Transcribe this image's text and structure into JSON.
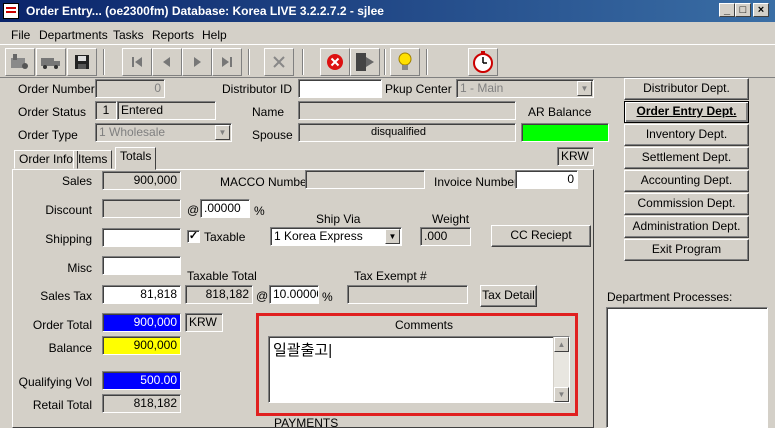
{
  "window": {
    "title": "Order Entry... (oe2300fm)  Database: Korea LIVE 3.2.2.7.2 - sjlee",
    "min": "_",
    "max": "□",
    "close": "×"
  },
  "menu": [
    "File",
    "Departments",
    "Tasks",
    "Reports",
    "Help"
  ],
  "toolbar": {
    "icons": [
      "tools-icon",
      "truck-icon",
      "save-icon",
      "first-record-icon",
      "previous-record-icon",
      "next-record-icon",
      "last-record-icon",
      "delete-icon",
      "cancel-icon",
      "exit-icon",
      "help-bulb-icon",
      "timer-icon"
    ]
  },
  "header": {
    "order_number_label": "Order Number",
    "order_number_value": "0",
    "distributor_id_label": "Distributor ID",
    "distributor_id_value": "",
    "pkup_center_label": "Pkup Center",
    "pkup_center_value": "1 - Main",
    "order_status_label": "Order Status",
    "order_status_code": "1",
    "order_status_value": "Entered",
    "name_label": "Name",
    "name_value": "",
    "ar_balance_label": "AR Balance",
    "ar_balance_color": "#00ff00",
    "order_type_label": "Order Type",
    "order_type_value": "1 Wholesale",
    "spouse_label": "Spouse",
    "spouse_value": "disqualified",
    "currency": "KRW"
  },
  "tabs": [
    "Order Info",
    "Items",
    "Totals"
  ],
  "active_tab": "Totals",
  "totals": {
    "sales_label": "Sales",
    "sales_value": "900,000",
    "macco_label": "MACCO Number",
    "macco_value": "",
    "invoice_label": "Invoice Number",
    "invoice_value": "0",
    "discount_label": "Discount",
    "discount_value": "",
    "discount_at": "@",
    "discount_pct": ".00000",
    "pct_sign": "%",
    "ship_via_label": "Ship Via",
    "ship_via_value": "1 Korea Express",
    "weight_label": "Weight",
    "weight_value": ".000",
    "shipping_label": "Shipping",
    "shipping_value": "",
    "taxable_label": "Taxable",
    "taxable_checked": "✓",
    "cc_button": "CC Reciept",
    "misc_label": "Misc",
    "misc_value": "",
    "taxable_total_label": "Taxable Total",
    "tax_exempt_label": "Tax Exempt #",
    "sales_tax_label": "Sales Tax",
    "sales_tax_value": "81,818",
    "taxable_total_value": "818,182",
    "tax_at": "@",
    "tax_rate": "10.00000",
    "tax_exempt_value": "",
    "tax_detail_button": "Tax Detail",
    "order_total_label": "Order Total",
    "order_total_value": "900,000",
    "order_total_color": "#0000ff",
    "order_total_currency": "KRW",
    "balance_label": "Balance",
    "balance_value": "900,000",
    "balance_color": "#ffff00",
    "qualifying_label": "Qualifying Vol",
    "qualifying_value": "500.00",
    "retail_label": "Retail Total",
    "retail_value": "818,182",
    "comments_label": "Comments",
    "comments_value": "일괄출고|",
    "payments_label": "PAYMENTS"
  },
  "departments": [
    "Distributor Dept.",
    "Order Entry Dept.",
    "Inventory Dept.",
    "Settlement Dept.",
    "Accounting Dept.",
    "Commission Dept.",
    "Administration Dept.",
    "Exit Program"
  ],
  "dept_processes_label": "Department Processes:"
}
